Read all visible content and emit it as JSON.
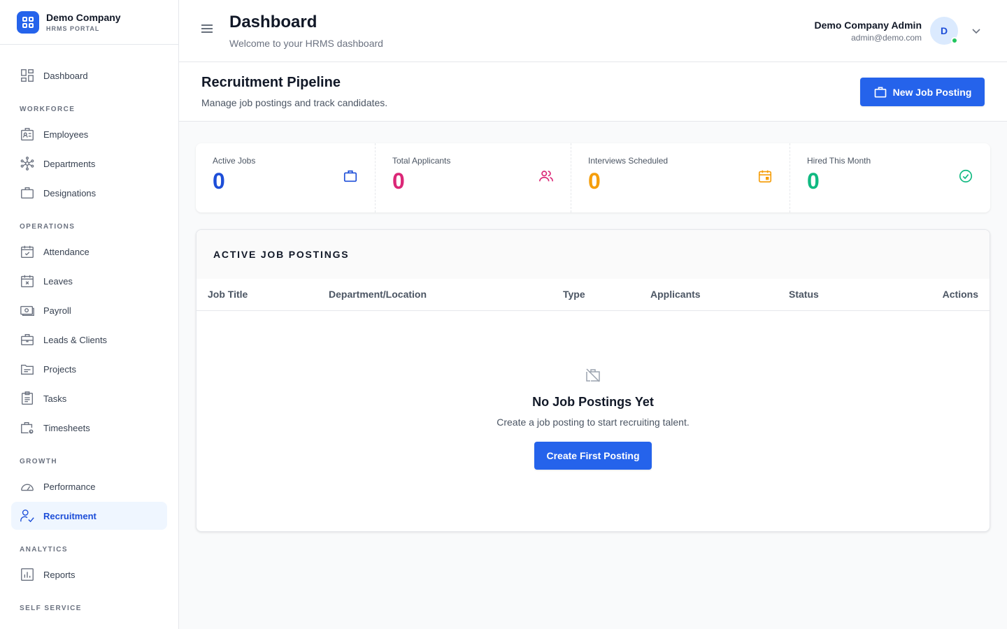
{
  "brand": {
    "name": "Demo Company",
    "subtitle": "HRMS PORTAL",
    "accent": "#2563eb"
  },
  "sidebar": {
    "dashboard": "Dashboard",
    "sections": {
      "workforce": "WORKFORCE",
      "operations": "OPERATIONS",
      "growth": "GROWTH",
      "analytics": "ANALYTICS",
      "self_service": "SELF SERVICE"
    },
    "items": {
      "employees": "Employees",
      "departments": "Departments",
      "designations": "Designations",
      "attendance": "Attendance",
      "leaves": "Leaves",
      "payroll": "Payroll",
      "leads": "Leads & Clients",
      "projects": "Projects",
      "tasks": "Tasks",
      "timesheets": "Timesheets",
      "performance": "Performance",
      "recruitment": "Recruitment",
      "reports": "Reports"
    },
    "active": "recruitment"
  },
  "header": {
    "title": "Dashboard",
    "subtitle": "Welcome to your HRMS dashboard",
    "user": {
      "name": "Demo Company Admin",
      "email": "admin@demo.com",
      "initial": "D",
      "online": true
    }
  },
  "page": {
    "title": "Recruitment Pipeline",
    "subtitle": "Manage job postings and track candidates.",
    "new_button": "New Job Posting"
  },
  "stats": [
    {
      "label": "Active Jobs",
      "value": "0",
      "color": "#1d4ed8",
      "icon": "briefcase-icon"
    },
    {
      "label": "Total Applicants",
      "value": "0",
      "color": "#db2777",
      "icon": "users-icon"
    },
    {
      "label": "Interviews Scheduled",
      "value": "0",
      "color": "#f59e0b",
      "icon": "calendar-icon"
    },
    {
      "label": "Hired This Month",
      "value": "0",
      "color": "#10b981",
      "icon": "check-circle-icon"
    }
  ],
  "postings": {
    "title": "ACTIVE JOB POSTINGS",
    "columns": {
      "job_title": "Job Title",
      "department": "Department/Location",
      "type": "Type",
      "applicants": "Applicants",
      "status": "Status",
      "actions": "Actions"
    },
    "empty": {
      "title": "No Job Postings Yet",
      "subtitle": "Create a job posting to start recruiting talent.",
      "button": "Create First Posting"
    }
  }
}
